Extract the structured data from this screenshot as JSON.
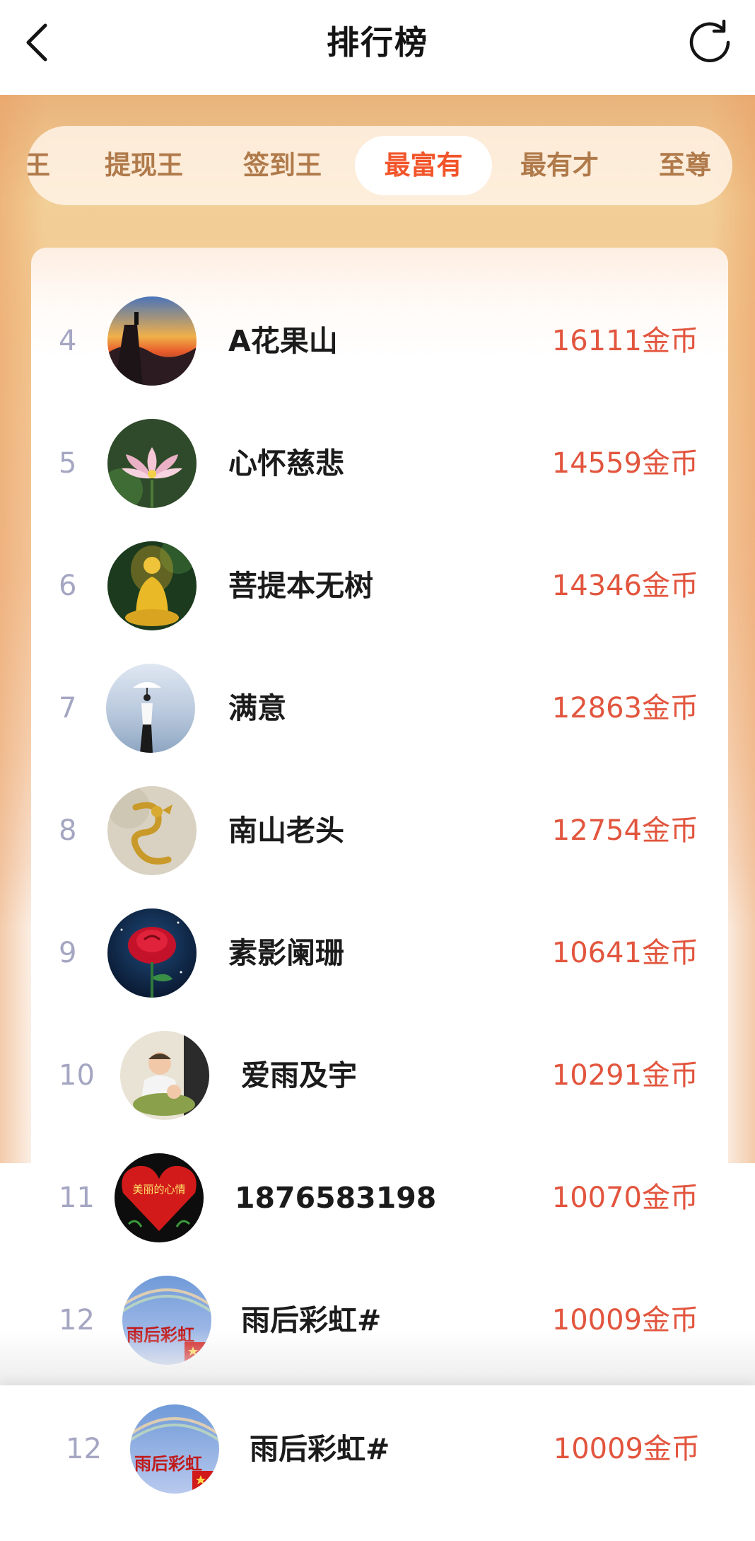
{
  "header": {
    "title": "排行榜"
  },
  "tabs": [
    {
      "label": "王",
      "active": false
    },
    {
      "label": "提现王",
      "active": false
    },
    {
      "label": "签到王",
      "active": false
    },
    {
      "label": "最富有",
      "active": true
    },
    {
      "label": "最有才",
      "active": false
    },
    {
      "label": "至尊",
      "active": false
    }
  ],
  "colors": {
    "accent": "#f2552a",
    "coin_text": "#e2553e",
    "rank_text": "#a4a6c2",
    "tab_text": "#b07a4b"
  },
  "ranking": [
    {
      "rank": "4",
      "name": "A花果山",
      "coins": "16111金币",
      "avatar": "mountain-sunset"
    },
    {
      "rank": "5",
      "name": "心怀慈悲",
      "coins": "14559金币",
      "avatar": "lotus"
    },
    {
      "rank": "6",
      "name": "菩提本无树",
      "coins": "14346金币",
      "avatar": "golden-buddha"
    },
    {
      "rank": "7",
      "name": "满意",
      "coins": "12863金币",
      "avatar": "woman-umbrella-sea"
    },
    {
      "rank": "8",
      "name": "南山老头",
      "coins": "12754金币",
      "avatar": "golden-dragon"
    },
    {
      "rank": "9",
      "name": "素影阑珊",
      "coins": "10641金币",
      "avatar": "red-rose"
    },
    {
      "rank": "10",
      "name": "爱雨及宇",
      "coins": "10291金币",
      "avatar": "children-photo"
    },
    {
      "rank": "11",
      "name": "1876583198",
      "coins": "10070金币",
      "avatar": "red-heart",
      "avatar_text": "美丽的心情"
    },
    {
      "rank": "12",
      "name": "雨后彩虹#",
      "coins": "10009金币",
      "avatar": "rainbow-flag",
      "avatar_text": "雨后彩虹"
    }
  ],
  "my_rank": {
    "rank": "12",
    "name": "雨后彩虹#",
    "coins": "10009金币",
    "avatar": "rainbow-flag",
    "avatar_text": "雨后彩虹"
  }
}
